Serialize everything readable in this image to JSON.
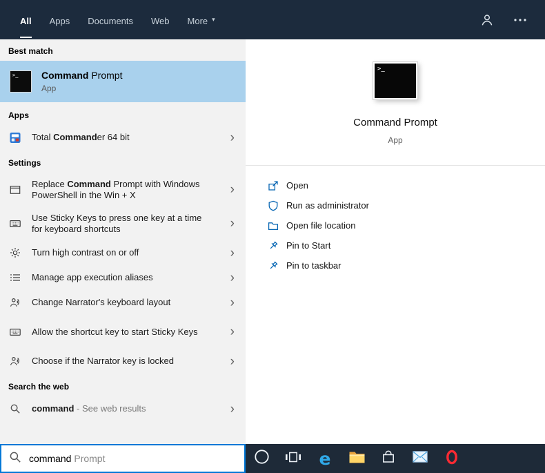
{
  "header": {
    "tabs": [
      {
        "label": "All",
        "active": true
      },
      {
        "label": "Apps",
        "active": false
      },
      {
        "label": "Documents",
        "active": false
      },
      {
        "label": "Web",
        "active": false
      },
      {
        "label": "More",
        "active": false
      }
    ]
  },
  "glyphs": {
    "more_caret": "▾",
    "chevron_right": "›",
    "cmd_prompt": ">_",
    "edge": "e"
  },
  "left_panel": {
    "best_match_label": "Best match",
    "best_match": {
      "title_bold": "Command",
      "title_rest": " Prompt",
      "subtitle": "App"
    },
    "apps_label": "Apps",
    "apps_items": [
      {
        "pre": "Total ",
        "bold": "Command",
        "post": "er 64 bit"
      }
    ],
    "settings_label": "Settings",
    "settings_items": [
      {
        "pre": "Replace ",
        "bold": "Command",
        "post": " Prompt with Windows PowerShell in the Win + X"
      },
      {
        "pre": "",
        "bold": "",
        "post": "Use Sticky Keys to press one key at a time for keyboard shortcuts"
      },
      {
        "pre": "",
        "bold": "",
        "post": "Turn high contrast on or off"
      },
      {
        "pre": "",
        "bold": "",
        "post": "Manage app execution aliases"
      },
      {
        "pre": "",
        "bold": "",
        "post": "Change Narrator's keyboard layout"
      },
      {
        "pre": "",
        "bold": "",
        "post": "Allow the shortcut key to start Sticky Keys"
      },
      {
        "pre": "",
        "bold": "",
        "post": "Choose if the Narrator key is locked"
      }
    ],
    "web_label": "Search the web",
    "web_item": {
      "bold": "command",
      "rest": " - See web results"
    }
  },
  "preview": {
    "title": "Command Prompt",
    "subtitle": "App",
    "actions": [
      {
        "label": "Open",
        "icon": "open-icon"
      },
      {
        "label": "Run as administrator",
        "icon": "admin-shield-icon"
      },
      {
        "label": "Open file location",
        "icon": "folder-icon"
      },
      {
        "label": "Pin to Start",
        "icon": "pin-icon"
      },
      {
        "label": "Pin to taskbar",
        "icon": "pin-icon"
      }
    ]
  },
  "search_box": {
    "typed": "command",
    "suggestion": " Prompt"
  },
  "taskbar_icons": [
    "cortana",
    "task-view",
    "edge",
    "file-explorer",
    "store",
    "mail",
    "opera"
  ],
  "colors": {
    "accent": "#0078d7",
    "header_bg": "#1c2b3d",
    "taskbar_bg": "#1e2a38",
    "selection_bg": "#a9d1ed",
    "panel_bg": "#f2f2f2",
    "action_icon_blue": "#0a68b4"
  }
}
